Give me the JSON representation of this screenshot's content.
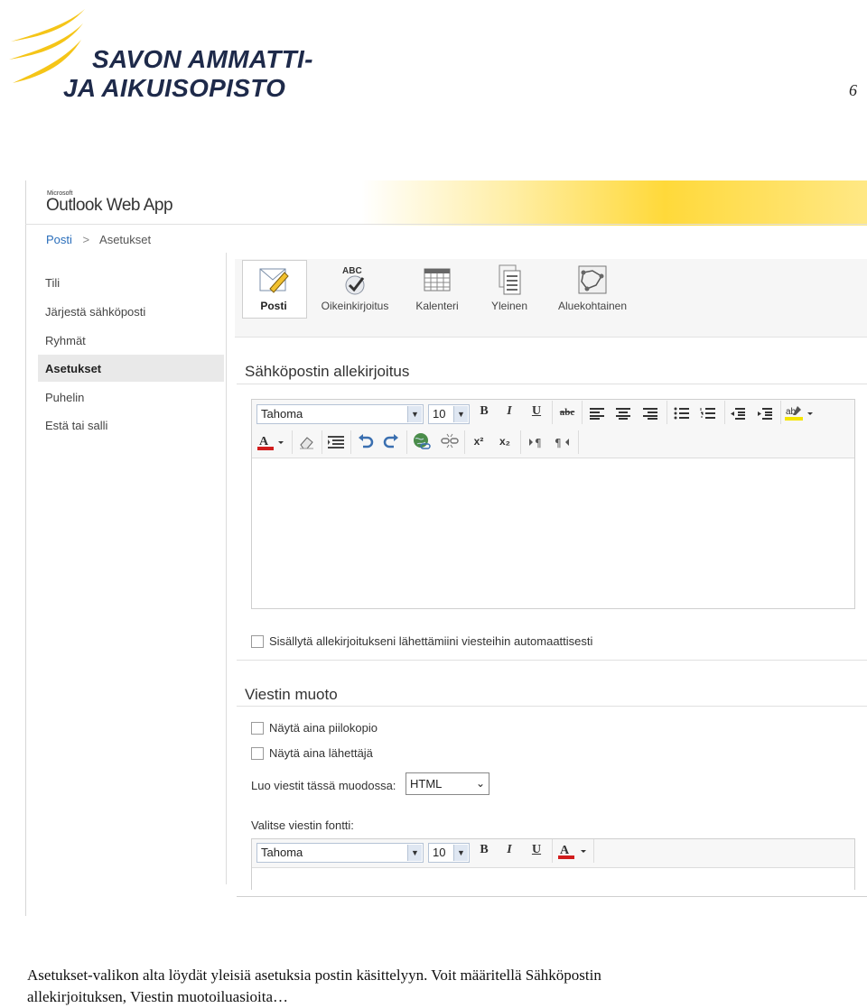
{
  "header": {
    "logo_line1": "SAVON AMMATTI-",
    "logo_line2": "JA AIKUISOPISTO",
    "page_number": "6"
  },
  "owa": {
    "brand_small": "Microsoft",
    "brand": "Outlook Web App",
    "breadcrumb": {
      "root": "Posti",
      "separator": ">",
      "current": "Asetukset"
    },
    "nav": [
      {
        "label": "Tili"
      },
      {
        "label": "Järjestä sähköposti"
      },
      {
        "label": "Ryhmät"
      },
      {
        "label": "Asetukset",
        "active": true
      },
      {
        "label": "Puhelin"
      },
      {
        "label": "Estä tai salli"
      }
    ],
    "ribbon": [
      {
        "label": "Posti",
        "icon": "mail-edit-icon",
        "selected": true
      },
      {
        "label": "Oikeinkirjoitus",
        "icon": "spellcheck-icon",
        "icon_text": "ABC"
      },
      {
        "label": "Kalenteri",
        "icon": "calendar-icon"
      },
      {
        "label": "Yleinen",
        "icon": "general-settings-icon"
      },
      {
        "label": "Aluekohtainen",
        "icon": "regional-map-icon"
      }
    ],
    "signature": {
      "title": "Sähköpostin allekirjoitus",
      "font": "Tahoma",
      "size": "10",
      "toolbar_row1": [
        "B",
        "I",
        "U",
        "abc"
      ],
      "toolbar_row2": [
        "x²",
        "x₂"
      ],
      "auto_include_label": "Sisällytä allekirjoitukseni lähettämiini viesteihin automaattisesti",
      "auto_include_checked": false
    },
    "message_format": {
      "title": "Viestin muoto",
      "always_bcc_label": "Näytä aina piilokopio",
      "always_bcc_checked": false,
      "always_from_label": "Näytä aina lähettäjä",
      "always_from_checked": false,
      "compose_format_label": "Luo viestit tässä muodossa:",
      "compose_format_value": "HTML",
      "font_label": "Valitse viestin fontti:",
      "font": "Tahoma",
      "size": "10",
      "toolbar": [
        "B",
        "I",
        "U"
      ]
    }
  },
  "caption": {
    "line1": "Asetukset-valikon alta löydät yleisiä asetuksia postin käsittelyyn. Voit määritellä Sähköpostin",
    "line2": "allekirjoituksen, Viestin muotoiluasioita…"
  },
  "colors": {
    "accent_yellow": "#f5c518",
    "link_blue": "#2a6ebb",
    "logo_navy": "#1e2a4a",
    "font_color_red": "#d11d1d"
  }
}
